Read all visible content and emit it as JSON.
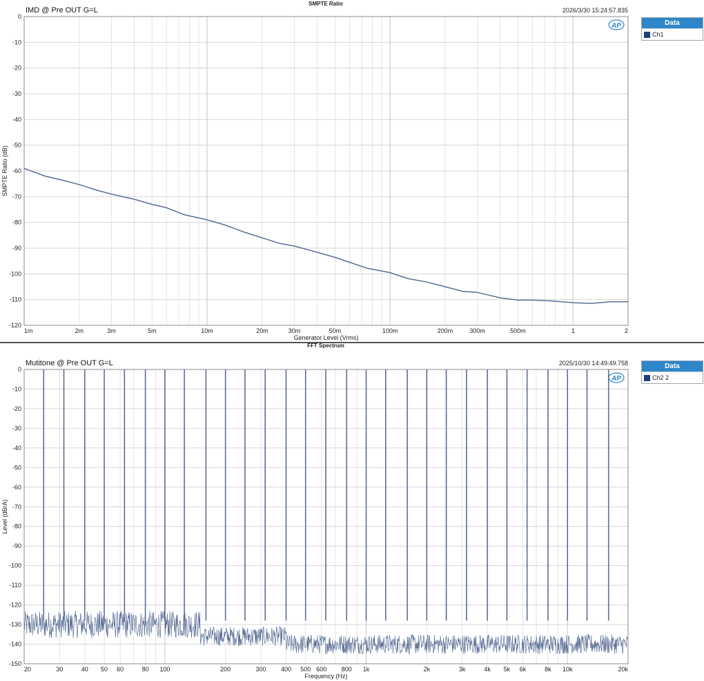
{
  "charts": [
    {
      "id": "smpte",
      "window_title": "SMPTE Ratio",
      "measurement_title": "IMD @ Pre OUT G=L",
      "timestamp": "2026/3/30 15:24:57.835",
      "logo": "AP",
      "legend": {
        "header": "Data",
        "items": [
          "Ch1"
        ]
      }
    },
    {
      "id": "fft",
      "window_title": "FFT Spectrum",
      "measurement_title": "Mutitone @ Pre OUT G=L",
      "timestamp": "2025/10/30 14:49:49.758",
      "logo": "AP",
      "legend": {
        "header": "Data",
        "items": [
          "Ch2  2"
        ]
      }
    }
  ],
  "colors": {
    "series": "#5a6e96",
    "legend_header": "#2e86c9",
    "swatch": "#1f3f7a"
  },
  "chart_data": [
    {
      "type": "line",
      "title": "SMPTE Ratio",
      "xlabel": "Generator Level (Vrms)",
      "ylabel": "SMPTE Ratio (dB)",
      "x_scale": "log",
      "xlim": [
        0.001,
        2
      ],
      "ylim": [
        -120,
        0
      ],
      "grid": true,
      "legend_position": "right",
      "x_ticks": [
        0.001,
        0.002,
        0.003,
        0.005,
        0.01,
        0.02,
        0.03,
        0.05,
        0.1,
        0.2,
        0.3,
        0.5,
        1,
        2
      ],
      "x_tick_labels": [
        "1m",
        "2m",
        "3m",
        "5m",
        "10m",
        "20m",
        "30m",
        "50m",
        "100m",
        "200m",
        "300m",
        "500m",
        "1",
        "2"
      ],
      "y_ticks": [
        0,
        -10,
        -20,
        -30,
        -40,
        -50,
        -60,
        -70,
        -80,
        -90,
        -100,
        -110,
        -120
      ],
      "y_tick_labels": [
        "0",
        "-10",
        "-20",
        "-30",
        "-40",
        "-50",
        "-60",
        "-70",
        "-80",
        "-90",
        "-100",
        "-110",
        "-120"
      ],
      "series": [
        {
          "name": "Ch1",
          "x": [
            0.001,
            0.0013,
            0.0016,
            0.002,
            0.0025,
            0.003,
            0.004,
            0.005,
            0.006,
            0.0075,
            0.01,
            0.0125,
            0.016,
            0.02,
            0.025,
            0.03,
            0.04,
            0.05,
            0.06,
            0.075,
            0.1,
            0.125,
            0.16,
            0.2,
            0.25,
            0.3,
            0.4,
            0.5,
            0.6,
            0.75,
            1.0,
            1.25,
            1.6,
            2.0
          ],
          "y": [
            -59,
            -62,
            -63.5,
            -65.3,
            -67.5,
            -69,
            -71,
            -73,
            -74.3,
            -77,
            -79,
            -81,
            -83.8,
            -86,
            -88.2,
            -89.2,
            -91.6,
            -93.6,
            -95.5,
            -97.8,
            -99.5,
            -101.8,
            -103.2,
            -105,
            -106.8,
            -107.2,
            -109.3,
            -110.2,
            -110.2,
            -110.5,
            -111.2,
            -111.5,
            -110.8,
            -110.8
          ]
        }
      ]
    },
    {
      "type": "line",
      "title": "FFT Spectrum",
      "xlabel": "Frequency (Hz)",
      "ylabel": "Level (dBrA)",
      "x_scale": "log",
      "xlim": [
        20,
        20000
      ],
      "ylim": [
        -150,
        0
      ],
      "grid": true,
      "legend_position": "right",
      "x_ticks": [
        20,
        30,
        40,
        50,
        60,
        80,
        100,
        200,
        300,
        400,
        500,
        600,
        800,
        1000,
        2000,
        3000,
        4000,
        5000,
        6000,
        8000,
        10000,
        20000
      ],
      "x_tick_labels": [
        "20",
        "30",
        "40",
        "50",
        "60",
        "80",
        "100",
        "200",
        "300",
        "400",
        "500",
        "600",
        "800",
        "1k",
        "2k",
        "3k",
        "4k",
        "5k",
        "6k",
        "8k",
        "10k",
        "20k"
      ],
      "y_ticks": [
        0,
        -10,
        -20,
        -30,
        -40,
        -50,
        -60,
        -70,
        -80,
        -90,
        -100,
        -110,
        -120,
        -130,
        -140,
        -150
      ],
      "y_tick_labels": [
        "0",
        "-10",
        "-20",
        "-30",
        "-40",
        "-50",
        "-60",
        "-70",
        "-80",
        "-90",
        "-100",
        "-110",
        "-120",
        "-130",
        "-140",
        "-150"
      ],
      "series": [
        {
          "name": "Ch2",
          "tone_frequencies": [
            25,
            31.5,
            40,
            50,
            63,
            80,
            100,
            125,
            160,
            200,
            250,
            315,
            400,
            500,
            630,
            800,
            1000,
            1250,
            1600,
            2000,
            2500,
            3150,
            4000,
            5000,
            6300,
            8000,
            10000,
            12500,
            16000
          ],
          "tone_level": 0,
          "noise_floor_low_freq": -130,
          "noise_floor_high_freq": -140
        }
      ]
    }
  ]
}
